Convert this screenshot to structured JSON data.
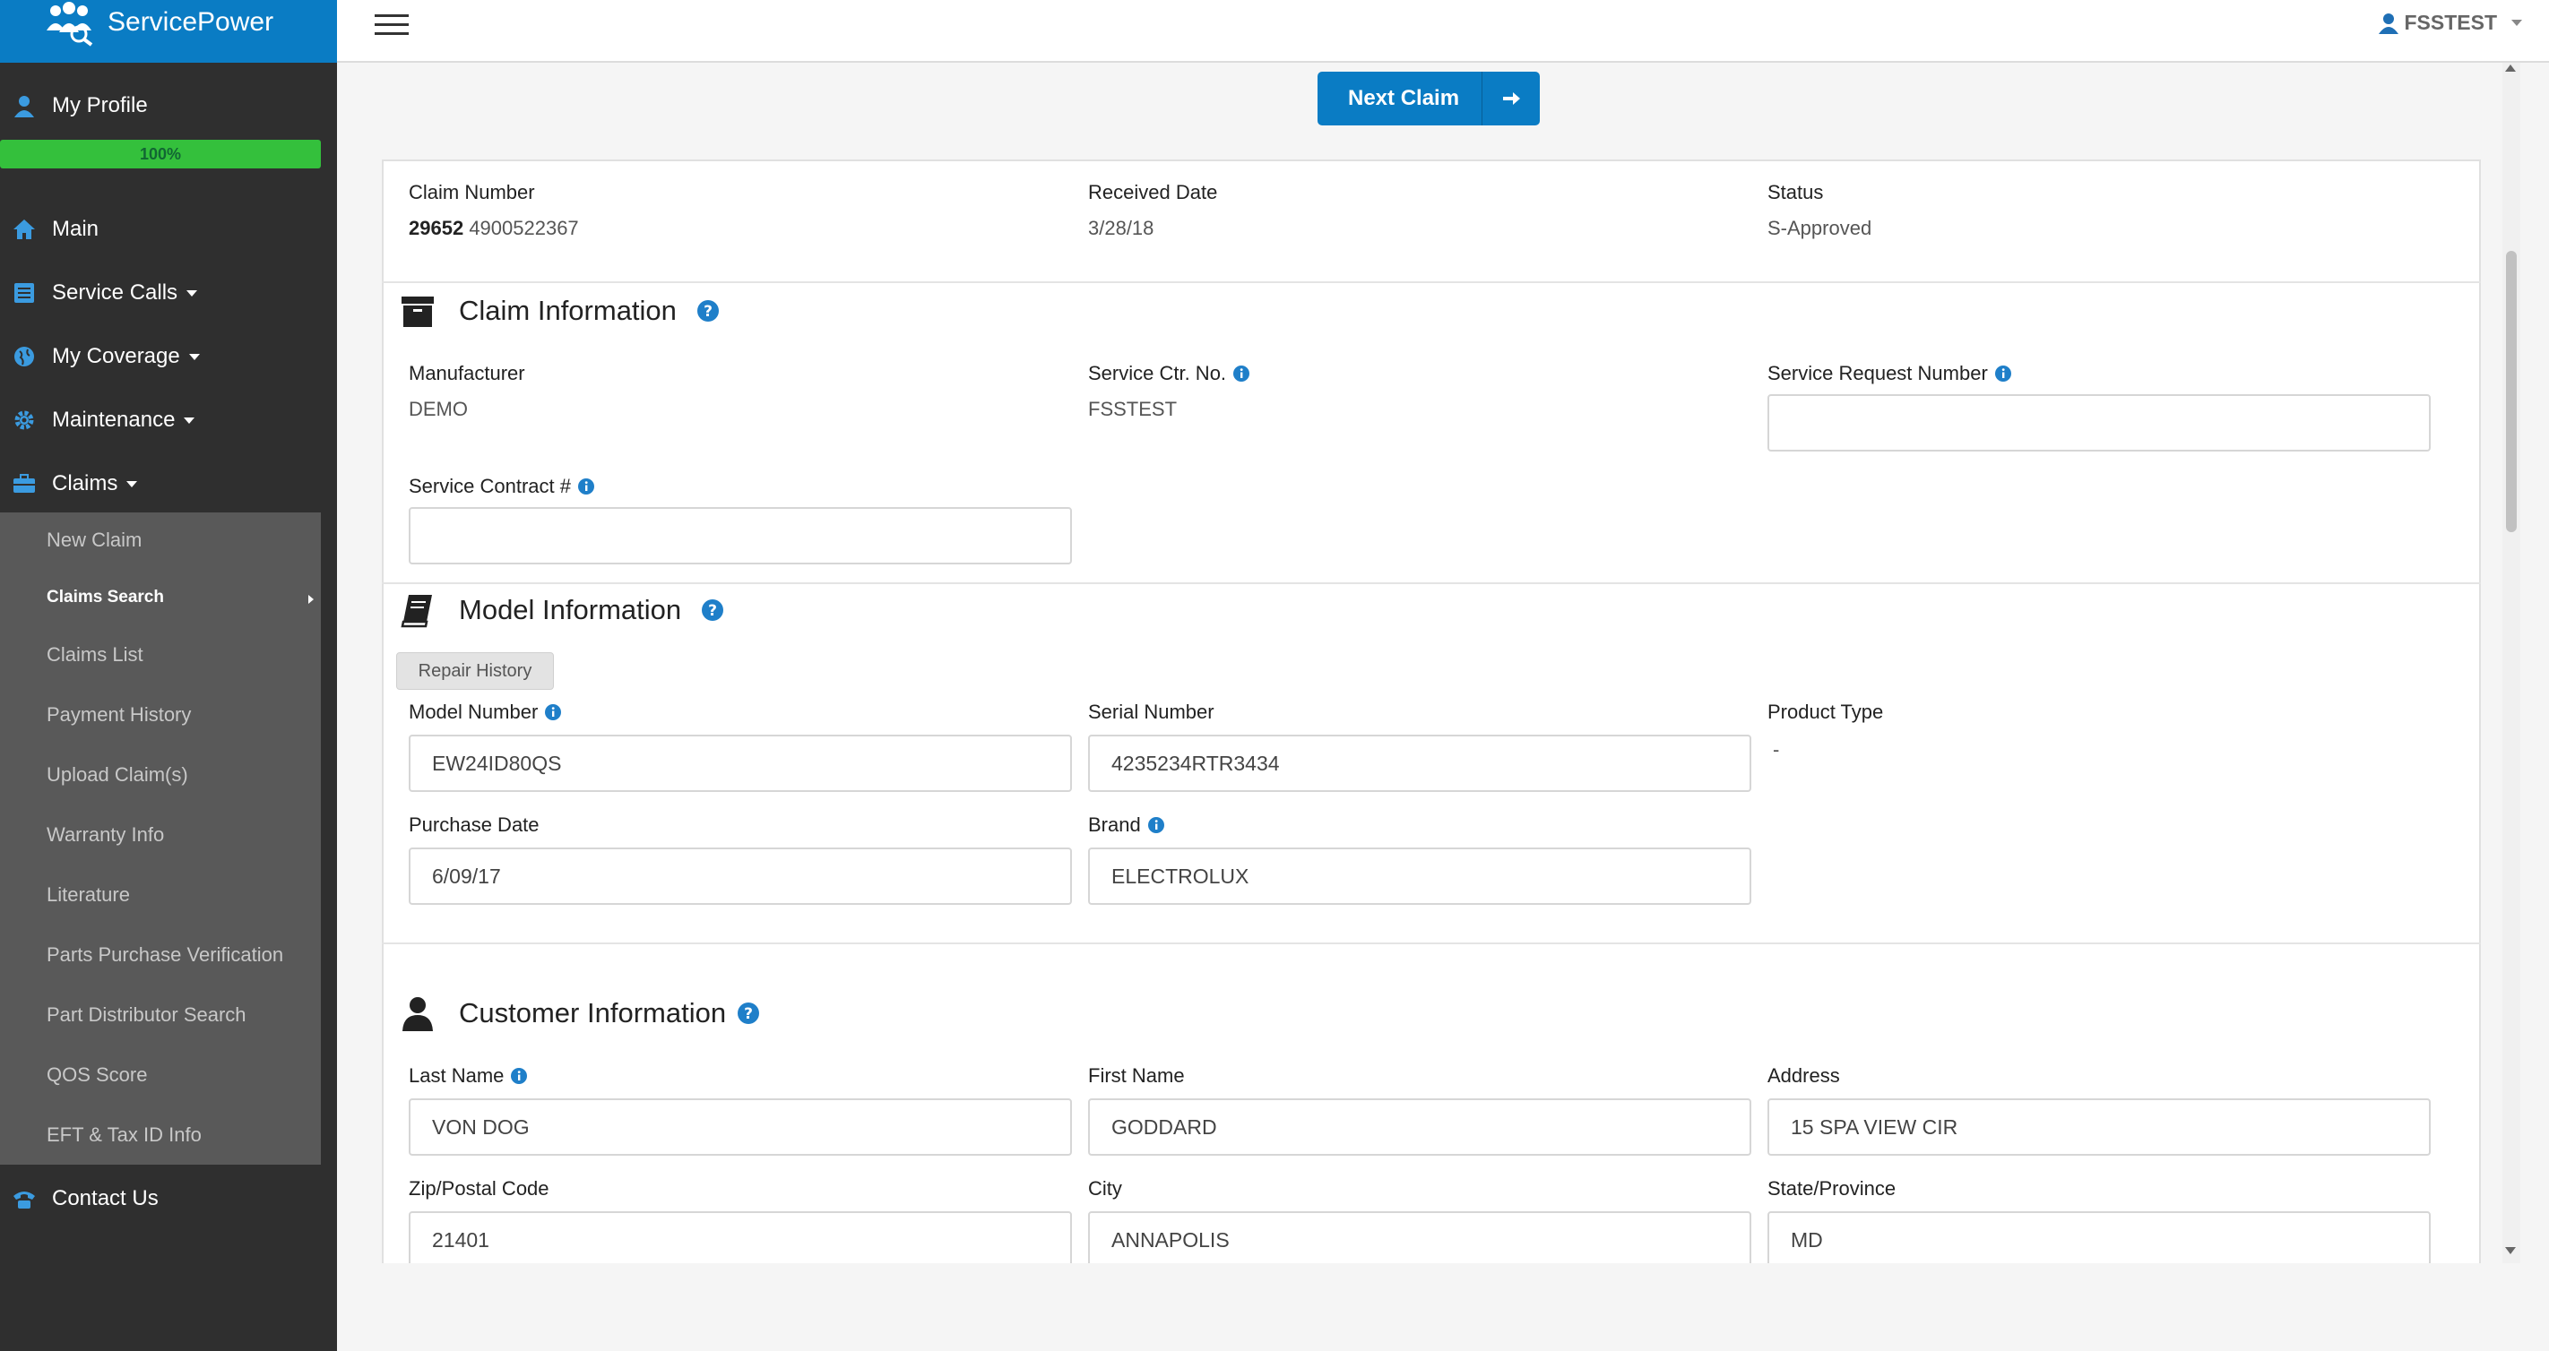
{
  "brand": {
    "name": "ServicePower"
  },
  "sidebar": {
    "profile": {
      "label": "My Profile",
      "progress": "100%"
    },
    "items": [
      {
        "label": "Main"
      },
      {
        "label": "Service Calls"
      },
      {
        "label": "My Coverage"
      },
      {
        "label": "Maintenance"
      },
      {
        "label": "Claims"
      }
    ],
    "claims_sub": [
      {
        "label": "New Claim"
      },
      {
        "label": "Claims Search"
      },
      {
        "label": "Claims List"
      },
      {
        "label": "Payment History"
      },
      {
        "label": "Upload Claim(s)"
      },
      {
        "label": "Warranty Info"
      },
      {
        "label": "Literature"
      },
      {
        "label": "Parts Purchase Verification"
      },
      {
        "label": "Part Distributor Search"
      },
      {
        "label": "QOS Score"
      },
      {
        "label": "EFT & Tax ID Info"
      }
    ],
    "contact": {
      "label": "Contact Us"
    }
  },
  "topbar": {
    "user": "FSSTEST"
  },
  "actions": {
    "next_claim": "Next Claim"
  },
  "claim_header": {
    "claim_number_label": "Claim Number",
    "claim_number_bold": "29652",
    "claim_number_rest": "4900522367",
    "received_label": "Received Date",
    "received_value": "3/28/18",
    "status_label": "Status",
    "status_value": "S-Approved"
  },
  "claim_info": {
    "title": "Claim Information",
    "manufacturer_label": "Manufacturer",
    "manufacturer_value": "DEMO",
    "service_ctr_label": "Service Ctr. No.",
    "service_ctr_value": "FSSTEST",
    "service_request_label": "Service Request Number",
    "service_request_value": "",
    "service_contract_label": "Service Contract #",
    "service_contract_value": ""
  },
  "model_info": {
    "title": "Model Information",
    "repair_history": "Repair History",
    "model_number_label": "Model Number",
    "model_number_value": "EW24ID80QS",
    "serial_label": "Serial Number",
    "serial_value": "4235234RTR3434",
    "product_type_label": "Product Type",
    "product_type_value": "-",
    "purchase_date_label": "Purchase Date",
    "purchase_date_value": "6/09/17",
    "brand_label": "Brand",
    "brand_value": "ELECTROLUX"
  },
  "customer_info": {
    "title": "Customer Information",
    "last_name_label": "Last Name",
    "last_name_value": "VON DOG",
    "first_name_label": "First Name",
    "first_name_value": "GODDARD",
    "address_label": "Address",
    "address_value": "15 SPA VIEW CIR",
    "zip_label": "Zip/Postal Code",
    "zip_value": "21401",
    "city_label": "City",
    "city_value": "ANNAPOLIS",
    "state_label": "State/Province",
    "state_value": "MD"
  },
  "colors": {
    "brand_blue": "#0a7cc4",
    "sidebar_dark": "#2f2f2f",
    "submenu_grey": "#595959",
    "progress_green": "#34c03c"
  }
}
